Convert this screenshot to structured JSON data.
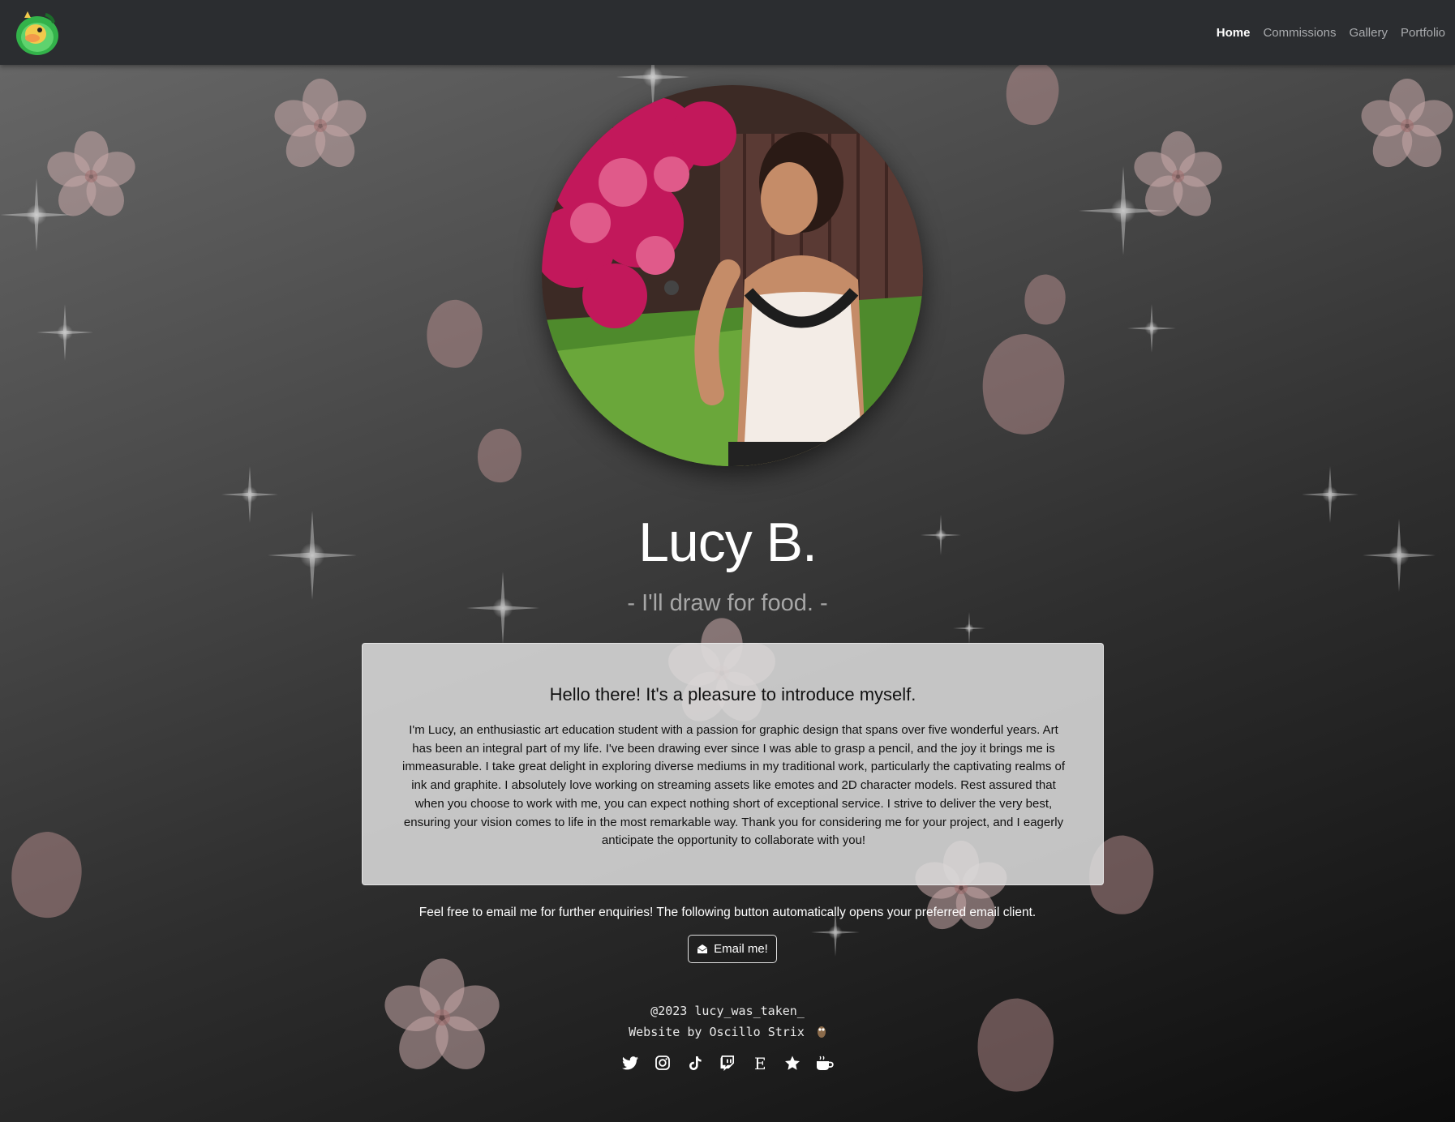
{
  "nav": {
    "logo_alt": "duck mascot logo",
    "links": [
      "Home",
      "Commissions",
      "Gallery",
      "Portfolio"
    ],
    "active": "Home"
  },
  "profile": {
    "name": "Lucy B.",
    "tagline": "- I'll draw for food. -"
  },
  "intro": {
    "heading": "Hello there! It's a pleasure to introduce myself.",
    "body": "I'm Lucy, an enthusiastic art education student with a passion for graphic design that spans over five wonderful years. Art has been an integral part of my life. I've been drawing ever since I was able to grasp a pencil, and the joy it brings me is immeasurable. I take great delight in exploring diverse mediums in my traditional work, particularly the captivating realms of ink and graphite. I absolutely love working on streaming assets like emotes and 2D character models. Rest assured that when you choose to work with me, you can expect nothing short of exceptional service. I strive to deliver the very best, ensuring your vision comes to life in the most remarkable way. Thank you for considering me for your project, and I eagerly anticipate the opportunity to collaborate with you!"
  },
  "contact": {
    "note": "Feel free to email me for further enquiries! The following button automatically opens your preferred email client.",
    "button_label": "Email me!",
    "button_icon": "envelope-open-icon"
  },
  "footer": {
    "copyright": "@2023 lucy_was_taken_",
    "credit": "Website by Oscillo Strix",
    "credit_icon": "owl-icon",
    "socials": [
      "twitter-icon",
      "instagram-icon",
      "tiktok-icon",
      "twitch-icon",
      "etsy-icon",
      "star-icon",
      "ko-fi-icon"
    ]
  },
  "colors": {
    "navbar": "#2b2d30",
    "card": "#dedede",
    "petal": "#c9a3a3",
    "subtitle": "#a7a7a7"
  }
}
